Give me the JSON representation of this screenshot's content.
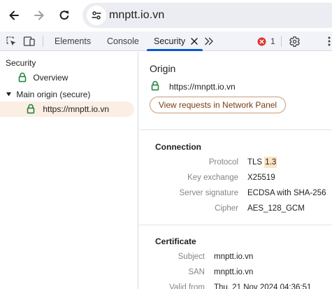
{
  "browser": {
    "url": "mnptt.io.vn"
  },
  "devtools": {
    "tabs": [
      {
        "label": "Elements"
      },
      {
        "label": "Console"
      },
      {
        "label": "Security"
      }
    ],
    "error_count": "1"
  },
  "sidebar": {
    "root_label": "Security",
    "overview_label": "Overview",
    "main_origin_label": "Main origin (secure)",
    "origin_item": "https://mnptt.io.vn"
  },
  "origin": {
    "title": "Origin",
    "url": "https://mnptt.io.vn",
    "network_button": "View requests in Network Panel"
  },
  "connection": {
    "title": "Connection",
    "rows": [
      {
        "label": "Protocol",
        "value_prefix": "TLS ",
        "value_highlight": "1.3"
      },
      {
        "label": "Key exchange",
        "value": "X25519"
      },
      {
        "label": "Server signature",
        "value": "ECDSA with SHA-256"
      },
      {
        "label": "Cipher",
        "value": "AES_128_GCM"
      }
    ]
  },
  "certificate": {
    "title": "Certificate",
    "rows": [
      {
        "label": "Subject",
        "value": "mnptt.io.vn"
      },
      {
        "label": "SAN",
        "value": "mnptt.io.vn"
      },
      {
        "label": "Valid from",
        "value": "Thu, 21 Nov 2024 04:36:51"
      }
    ]
  },
  "colors": {
    "lock_green": "#188038",
    "active_tab": "#0b57d0",
    "selection_bg": "#fbeee3",
    "error_red": "#dc362e"
  },
  "icons": [
    "back-arrow-icon",
    "forward-arrow-icon",
    "reload-icon",
    "site-info-icon",
    "inspect-element-icon",
    "device-toolbar-icon",
    "close-icon",
    "more-tabs-icon",
    "error-icon",
    "gear-icon",
    "kebab-menu-icon",
    "lock-icon",
    "triangle-down-icon"
  ]
}
